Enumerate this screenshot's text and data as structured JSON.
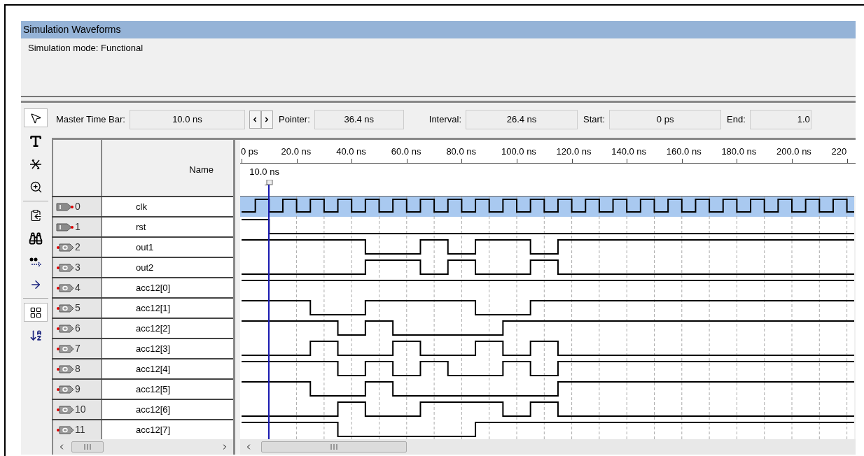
{
  "window": {
    "title": "Simulation Waveforms"
  },
  "mode_text": "Simulation mode: Functional",
  "tools": [
    {
      "kind": "pointer",
      "selected": true
    },
    {
      "kind": "text",
      "selected": false
    },
    {
      "kind": "node",
      "selected": false
    },
    {
      "kind": "zoom",
      "selected": false
    },
    {
      "kind": "copy",
      "selected": false
    },
    {
      "kind": "find",
      "selected": false
    },
    {
      "kind": "find_next",
      "selected": false
    },
    {
      "kind": "goto",
      "selected": false
    },
    {
      "kind": "snap",
      "selected": true
    },
    {
      "kind": "sort",
      "selected": false
    }
  ],
  "toolbar_fields": [
    {
      "label": "Master Time Bar:",
      "value": "10.0 ns",
      "kind": "with_arrows"
    },
    {
      "label": "Pointer:",
      "value": "36.4 ns",
      "kind": "plain"
    },
    {
      "label": "Interval:",
      "value": "26.4 ns",
      "kind": "plain"
    },
    {
      "label": "Start:",
      "value": "0 ps",
      "kind": "plain"
    },
    {
      "label": "End:",
      "value": "1.0",
      "kind": "cut"
    }
  ],
  "name_header": "Name",
  "ruler": {
    "ticks": [
      "0 ps",
      "20.0 ns",
      "40.0 ns",
      "60.0 ns",
      "80.0 ns",
      "100.0 ns",
      "120.0 ns",
      "140.0 ns",
      "160.0 ns",
      "180.0 ns",
      "200.0 ns",
      "220"
    ]
  },
  "marker": {
    "label": "10.0 ns"
  },
  "signals": [
    {
      "index": "0",
      "name": "clk",
      "kind": "input",
      "selected": true
    },
    {
      "index": "1",
      "name": "rst",
      "kind": "input",
      "selected": false
    },
    {
      "index": "2",
      "name": "out1",
      "kind": "output",
      "selected": false
    },
    {
      "index": "3",
      "name": "out2",
      "kind": "output",
      "selected": false
    },
    {
      "index": "4",
      "name": "acc12[0]",
      "kind": "output",
      "selected": false
    },
    {
      "index": "5",
      "name": "acc12[1]",
      "kind": "output",
      "selected": false
    },
    {
      "index": "6",
      "name": "acc12[2]",
      "kind": "output",
      "selected": false
    },
    {
      "index": "7",
      "name": "acc12[3]",
      "kind": "output",
      "selected": false
    },
    {
      "index": "8",
      "name": "acc12[4]",
      "kind": "output",
      "selected": false
    },
    {
      "index": "9",
      "name": "acc12[5]",
      "kind": "output",
      "selected": false
    },
    {
      "index": "10",
      "name": "acc12[6]",
      "kind": "output",
      "selected": false
    },
    {
      "index": "11",
      "name": "acc12[7]",
      "kind": "output",
      "selected": false
    }
  ]
}
